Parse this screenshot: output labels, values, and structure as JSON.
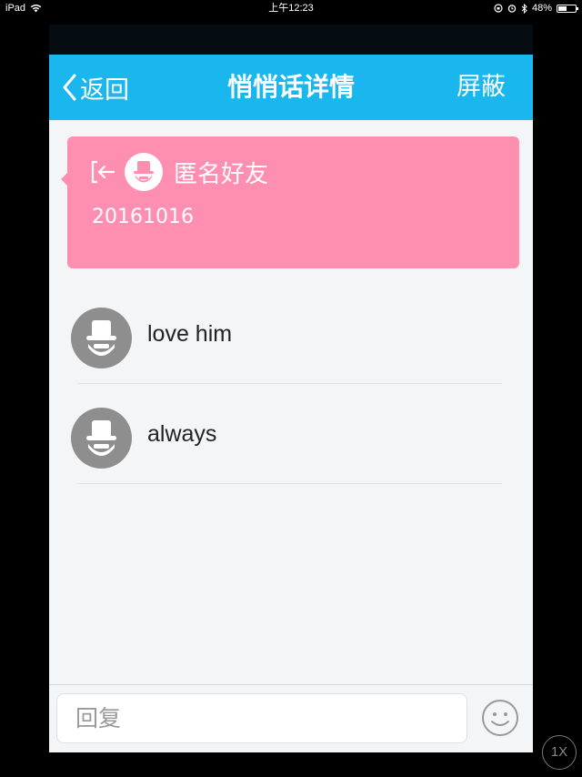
{
  "status_bar": {
    "device": "iPad",
    "time": "上午12:23",
    "battery": "48%",
    "battery_level": 0.48
  },
  "nav": {
    "back_label": "返回",
    "title": "悄悄话详情",
    "action_label": "屏蔽"
  },
  "card": {
    "name": "匿名好友",
    "date": "20161016",
    "color": "#ff8fb0"
  },
  "messages": [
    {
      "text": "love him"
    },
    {
      "text": "always"
    }
  ],
  "composer": {
    "placeholder": "回复"
  },
  "zoom_button": {
    "label": "1X"
  },
  "colors": {
    "nav_bar": "#1ab6ee",
    "page_bg": "#f4f5f7"
  }
}
